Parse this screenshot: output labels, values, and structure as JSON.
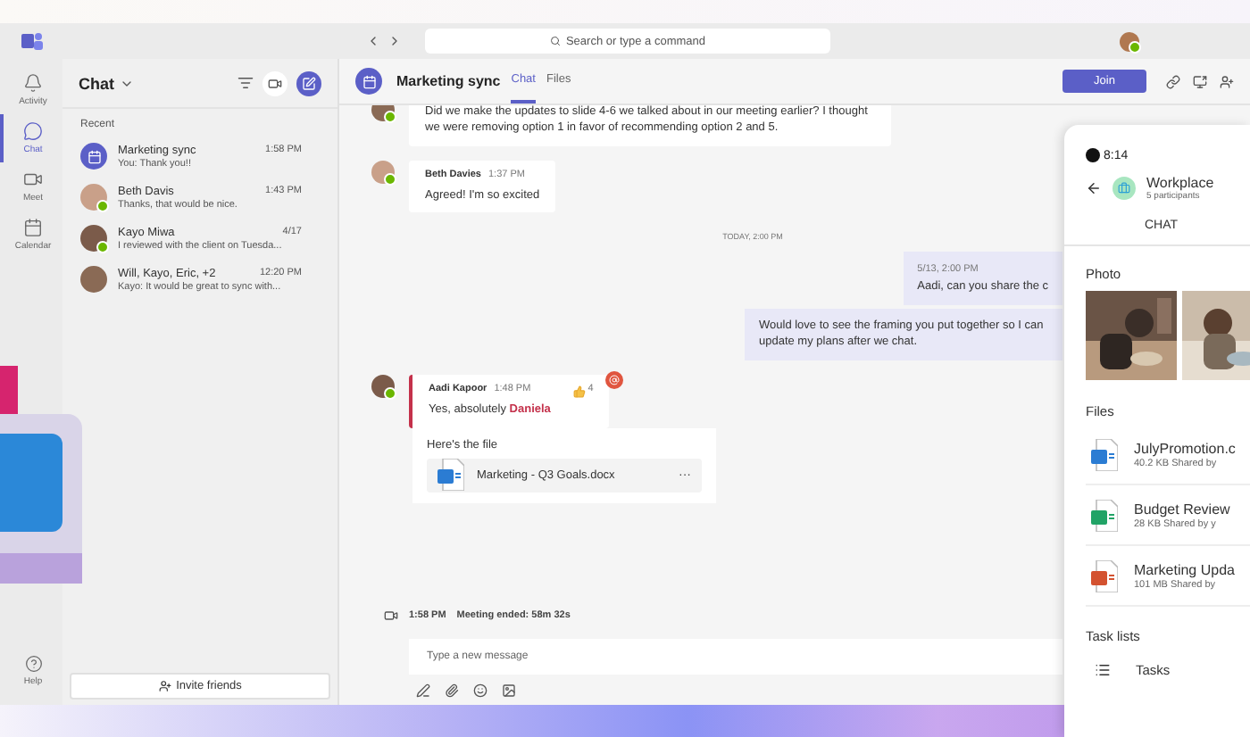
{
  "title_bar": {
    "search_placeholder": "Search or type a command"
  },
  "rail": {
    "items": [
      {
        "label": "Activity",
        "selected": false
      },
      {
        "label": "Chat",
        "selected": true
      },
      {
        "label": "Meet",
        "selected": false
      },
      {
        "label": "Calendar",
        "selected": false
      }
    ],
    "help": "Help"
  },
  "chat_list": {
    "title": "Chat",
    "section": "Recent",
    "items": [
      {
        "kind": "group",
        "name": "Marketing sync",
        "preview": "You: Thank you!!",
        "time": "1:58 PM"
      },
      {
        "kind": "person",
        "name": "Beth Davis",
        "preview": "Thanks, that would be nice.",
        "time": "1:43 PM"
      },
      {
        "kind": "person",
        "name": "Kayo Miwa",
        "preview": "I reviewed with the client on Tuesda...",
        "time": "4/17"
      },
      {
        "kind": "person",
        "name": "Will, Kayo, Eric, +2",
        "preview": "Kayo: It would be great to sync with...",
        "time": "12:20 PM"
      }
    ],
    "invite": "Invite friends"
  },
  "conversation": {
    "title": "Marketing sync",
    "tabs": [
      {
        "label": "Chat",
        "selected": true
      },
      {
        "label": "Files",
        "selected": false
      }
    ],
    "join": "Join",
    "messages": [
      {
        "kind": "incoming",
        "text": "Did we make the updates to slide 4-6 we talked about in our meeting earlier? I thought we were removing option 1 in favor of recommending option 2 and 5."
      },
      {
        "kind": "incoming",
        "author": "Beth Davies",
        "time": "1:37 PM",
        "text": "Agreed! I'm so excited"
      },
      {
        "kind": "divider",
        "text": "TODAY, 2:00 PM"
      },
      {
        "kind": "outgoing",
        "time": "5/13, 2:00 PM",
        "text": "Aadi, can you share the c"
      },
      {
        "kind": "outgoing",
        "text": "Would love to see the framing you put together so I can update my plans after we chat."
      },
      {
        "kind": "incoming",
        "author": "Aadi Kapoor",
        "time": "1:48 PM",
        "text": "Yes, absolutely **Daniela**",
        "important": true,
        "reaction_count": "4",
        "attachment": {
          "caption": "Here's the file",
          "file": "Marketing - Q3 Goals.docx",
          "more": "···"
        }
      }
    ],
    "meeting": {
      "time": "1:58 PM",
      "text": "Meeting ended: 58m 32s"
    },
    "compose_placeholder": "Type a new message"
  },
  "phone": {
    "time": "8:14",
    "title": "Workplace",
    "subtitle": "5 participants",
    "tab": "CHAT",
    "photo_heading": "Photo",
    "files_heading": "Files",
    "files": [
      {
        "kind": "document",
        "name": "JulyPromotion.c",
        "meta": "40.2 KB Shared by"
      },
      {
        "kind": "spreadsheet",
        "name": "Budget Review",
        "meta": "28 KB Shared by y"
      },
      {
        "kind": "slides",
        "name": "Marketing Upda",
        "meta": "101 MB Shared by"
      }
    ],
    "tasks_heading": "Task lists",
    "tasks": [
      {
        "label": "Tasks"
      }
    ]
  }
}
